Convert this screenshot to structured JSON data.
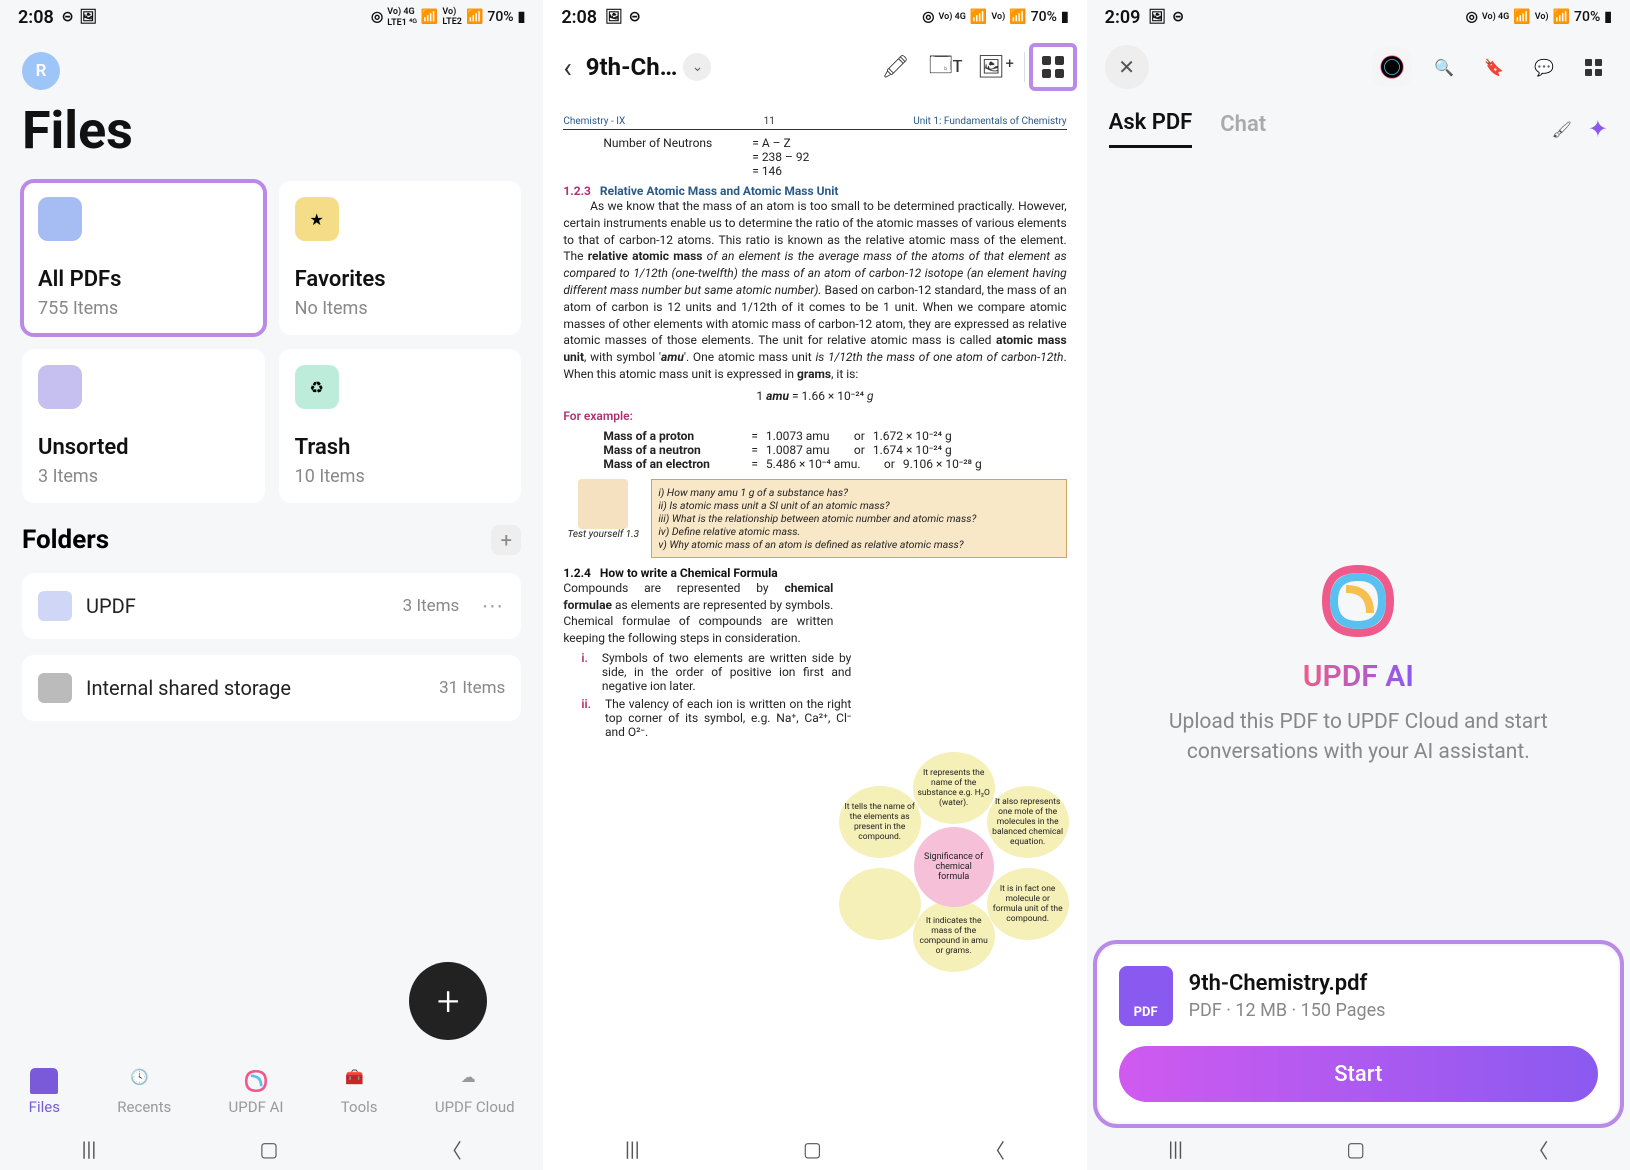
{
  "panel1": {
    "status": {
      "time": "2:08",
      "battery": "70%"
    },
    "avatar": "R",
    "title": "Files",
    "cards": [
      {
        "title": "All PDFs",
        "sub": "755 Items"
      },
      {
        "title": "Favorites",
        "sub": "No Items"
      },
      {
        "title": "Unsorted",
        "sub": "3 Items"
      },
      {
        "title": "Trash",
        "sub": "10 Items"
      }
    ],
    "folders_label": "Folders",
    "folders": [
      {
        "name": "UPDF",
        "count": "3 Items"
      },
      {
        "name": "Internal shared storage",
        "count": "31 Items"
      }
    ],
    "nav": [
      "Files",
      "Recents",
      "UPDF AI",
      "Tools",
      "UPDF Cloud"
    ]
  },
  "panel2": {
    "status": {
      "time": "2:08",
      "battery": "70%"
    },
    "filename": "9th-Ch…",
    "page": {
      "chapter": "Chemistry - IX",
      "pageno": "11",
      "unit": "Unit 1: Fundamentals of Chemistry",
      "neutrons_label": "Number of Neutrons",
      "neutrons_eq": [
        "= A – Z",
        "= 238 – 92",
        "= 146"
      ],
      "sec_123": "1.2.3   Relative Atomic Mass and Atomic Mass Unit",
      "body_123": "As we know that the mass of an atom is too small to be determined practically. However, certain instruments enable us to determine the ratio of the atomic masses of various elements to that of carbon-12 atoms. This ratio is known as the relative atomic mass of the element. The ",
      "relatmass": "relative atomic mass",
      "relatmass_def": " of an element is the average mass of the atoms of that element as compared to 1/12th (one-twelfth) the mass of an atom of carbon-12 isotope (an element having different mass number but same atomic number).",
      "body_123b": " Based on carbon-12 standard, the mass of an atom of carbon is 12 units and 1/12th of it comes to be 1 unit. When we compare atomic masses of other elements with atomic mass of carbon-12 atom, they are expressed as relative atomic masses of those elements. The unit for relative atomic mass is called ",
      "amu": "atomic mass unit",
      "amu_sym": ", with symbol '",
      "amu_sym2": "amu",
      "amu_def": "'. One atomic mass unit ",
      "amu_def2": "is 1/12th the mass of one atom of carbon-12th",
      "amu_def3": ". When this atomic mass unit is expressed in ",
      "grams": "grams",
      "amu_end": ", it is:",
      "amu_eq": "1 amu = 1.66 × 10⁻²⁴ g",
      "forex": "For example:",
      "masses": [
        [
          "Mass of a proton",
          "=",
          "1.0073 amu",
          "or",
          "1.672 × 10⁻²⁴ g"
        ],
        [
          "Mass of a neutron",
          "=",
          "1.0087 amu",
          "or",
          "1.674 × 10⁻²⁴ g"
        ],
        [
          "Mass of an electron",
          "=",
          "5.486 × 10⁻⁴ amu.",
          "or",
          "9.106 × 10⁻²⁸ g"
        ]
      ],
      "testyourself": "Test yourself 1.3",
      "questions": [
        "i)  How many amu 1 g of a substance has?",
        "ii)  Is atomic mass unit a SI unit of an atomic mass?",
        "iii)  What is the relationship between atomic number and atomic mass?",
        "iv)  Define relative atomic mass.",
        "v)  Why atomic mass of an atom is defined as relative atomic mass?"
      ],
      "sec_124": "1.2.4   How to write a Chemical Formula",
      "body_124a": "Compounds are represented by ",
      "chemformulae": "chemical formulae",
      "body_124b": " as elements are represented by symbols. Chemical formulae of compounds are written keeping the following steps in consideration.",
      "list": [
        "Symbols of two elements are written side by side, in the order of positive ion first and negative ion later.",
        "The valency of each ion is written on the right top corner of its symbol, e.g. Na⁺, Ca²⁺, Cl⁻ and O²⁻."
      ],
      "flower_center": "Significance of chemical formula",
      "petals": [
        "It represents the name of the substance e.g. H₂O (water).",
        "It also represents one mole of the molecules in the balanced chemical equation.",
        "It is in fact one molecule or formula unit of the compound.",
        "It indicates the mass of the compound in amu or grams.",
        "",
        "It tells the name of the elements as present in the compound."
      ]
    }
  },
  "panel3": {
    "status": {
      "time": "2:09",
      "battery": "70%"
    },
    "tabs": {
      "ask": "Ask PDF",
      "chat": "Chat"
    },
    "ai_title": "UPDF AI",
    "ai_sub": "Upload this PDF to UPDF Cloud and start conversations with your AI assistant.",
    "file": {
      "name": "9th-Chemistry.pdf",
      "meta": "PDF · 12 MB · 150 Pages"
    },
    "start": "Start"
  }
}
